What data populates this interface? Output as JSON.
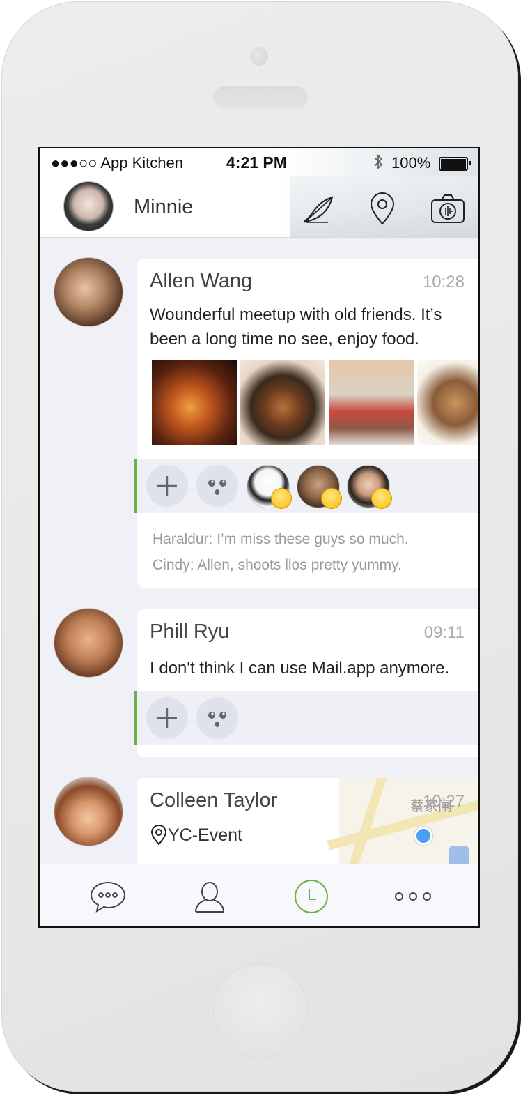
{
  "status_bar": {
    "carrier": "●●●○○ App Kitchen",
    "time": "4:21 PM",
    "battery_percent": "100%"
  },
  "header": {
    "user_name": "Minnie",
    "icons": [
      "compose-feather-icon",
      "location-pin-icon",
      "camera-icon"
    ]
  },
  "feed": [
    {
      "author": "Allen Wang",
      "time": "10:28",
      "text": "Wounderful meetup with old friends. It’s been a long time no see, enjoy food.",
      "photo_count": 4,
      "reactions": [
        "panda-sweat-emoji",
        "heart-eyes-emoji",
        "thumbs-up-emoji"
      ],
      "comments": [
        "Haraldur: I’m miss these guys so much.",
        "Cindy: Allen, shoots llos pretty yummy."
      ]
    },
    {
      "author": "Phill Ryu",
      "time": "09:11",
      "text": "I don't think I can use Mail.app anymore."
    },
    {
      "author": "Colleen Taylor",
      "time": "10:27",
      "location": "YC-Event",
      "map_label": "蔡家闸"
    }
  ],
  "tabbar": {
    "tabs": [
      "chat-bubble-icon",
      "contacts-icon",
      "clock-icon",
      "more-dots-icon"
    ],
    "active": "clock-icon",
    "accent_color": "#6ab04c"
  }
}
